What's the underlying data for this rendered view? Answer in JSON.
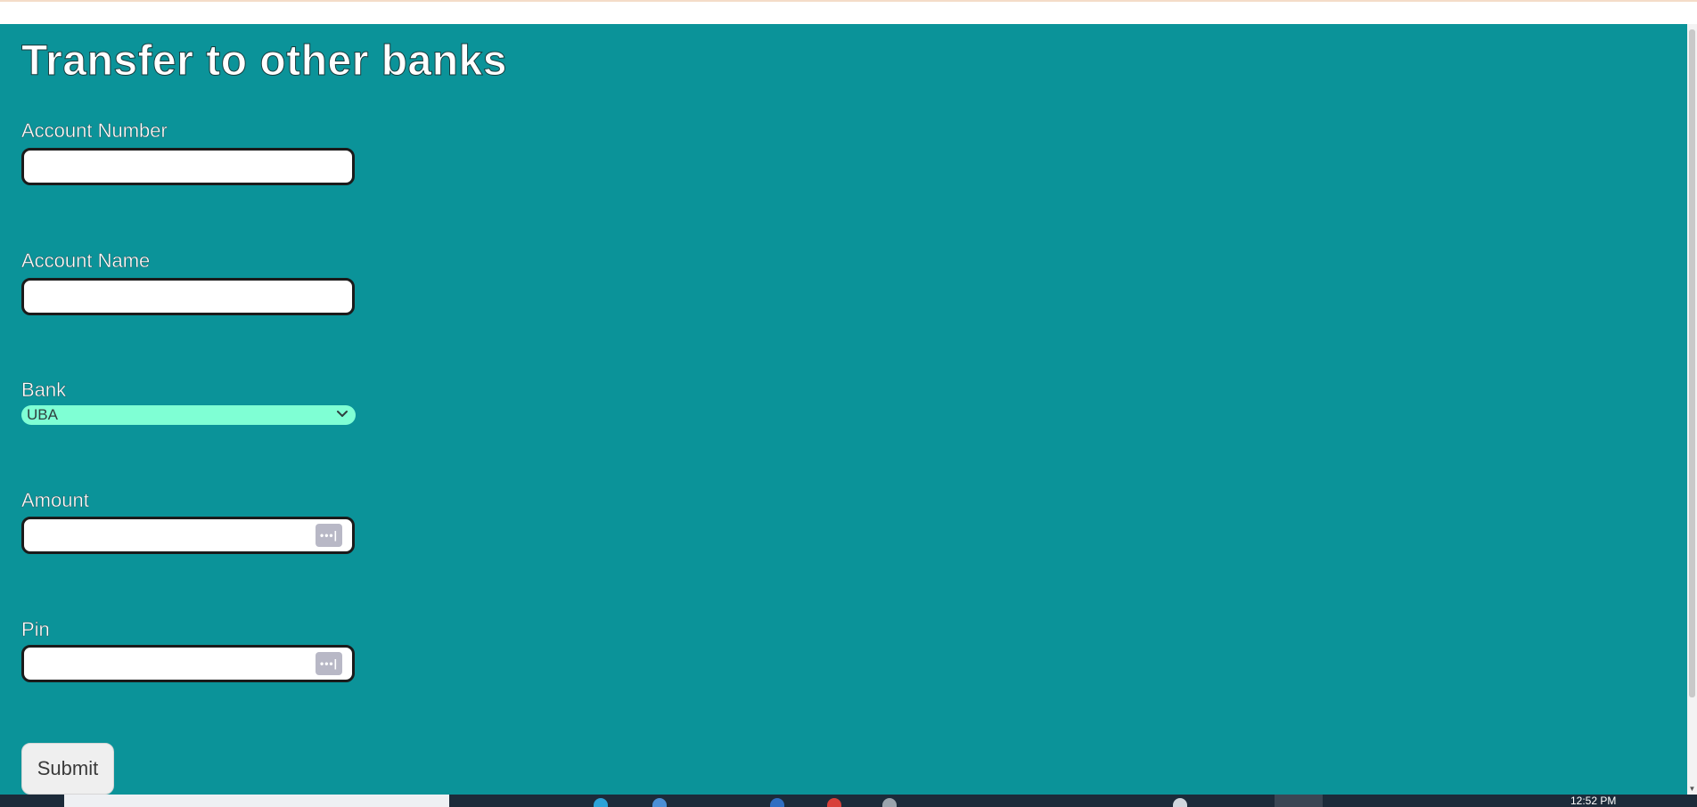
{
  "page": {
    "title": "Transfer to other banks",
    "background_color": "#0b9399"
  },
  "form": {
    "account_number": {
      "label": "Account Number",
      "value": "",
      "placeholder": ""
    },
    "account_name": {
      "label": "Account Name",
      "value": "",
      "placeholder": ""
    },
    "bank": {
      "label": "Bank",
      "selected": "UBA",
      "select_color": "#7fffd4"
    },
    "amount": {
      "label": "Amount",
      "value": "",
      "icon": "password-manager-icon"
    },
    "pin": {
      "label": "Pin",
      "value": "",
      "icon": "password-manager-icon"
    },
    "submit_label": "Submit"
  },
  "taskbar": {
    "clock": "12:52 PM"
  }
}
